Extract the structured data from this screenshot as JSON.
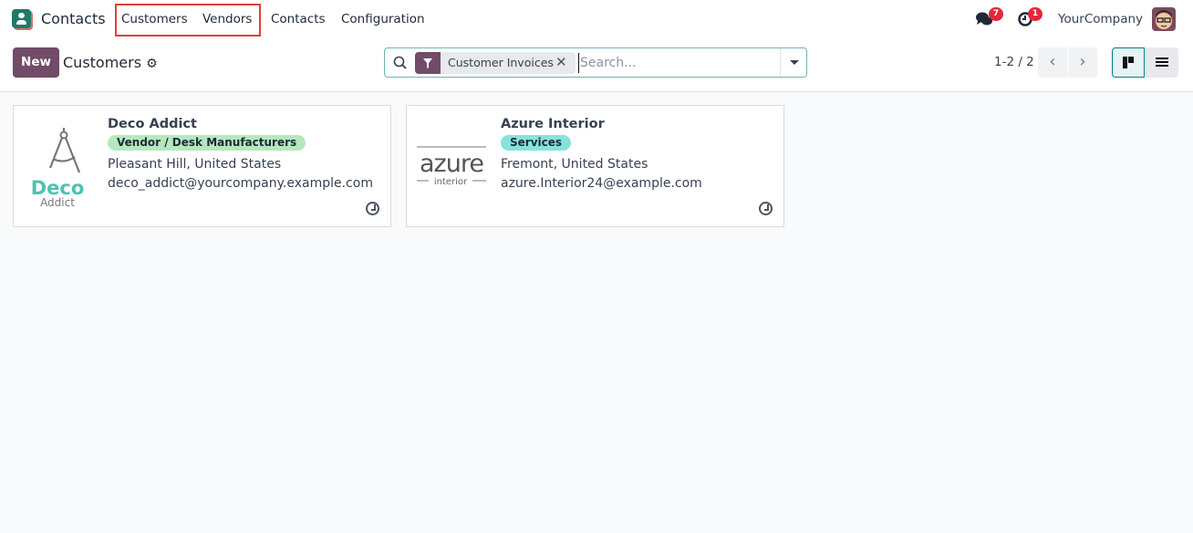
{
  "app": {
    "name": "Contacts",
    "icon": "contacts-app-icon"
  },
  "nav": {
    "items": [
      "Customers",
      "Vendors",
      "Contacts",
      "Configuration"
    ],
    "messages_count": "7",
    "activities_count": "1",
    "company": "YourCompany"
  },
  "control": {
    "new_label": "New",
    "title": "Customers",
    "facet_label": "Customer Invoices",
    "search_placeholder": "Search...",
    "pager": "1-2 / 2",
    "prev": "‹",
    "next": "›"
  },
  "colors": {
    "brand": "#714b67",
    "highlight": "#e53e3e",
    "tag_vendor": "#b5e8bd",
    "tag_services": "#86e3dc"
  },
  "cards": [
    {
      "name": "Deco Addict",
      "tag": "Vendor / Desk Manufacturers",
      "location": "Pleasant Hill, United States",
      "email": "deco_addict@yourcompany.example.com",
      "logo_text": [
        "Deco",
        "Addict"
      ]
    },
    {
      "name": "Azure Interior",
      "tag": "Services",
      "location": "Fremont, United States",
      "email": "azure.Interior24@example.com",
      "logo_text": [
        "azure",
        "interior"
      ]
    }
  ]
}
